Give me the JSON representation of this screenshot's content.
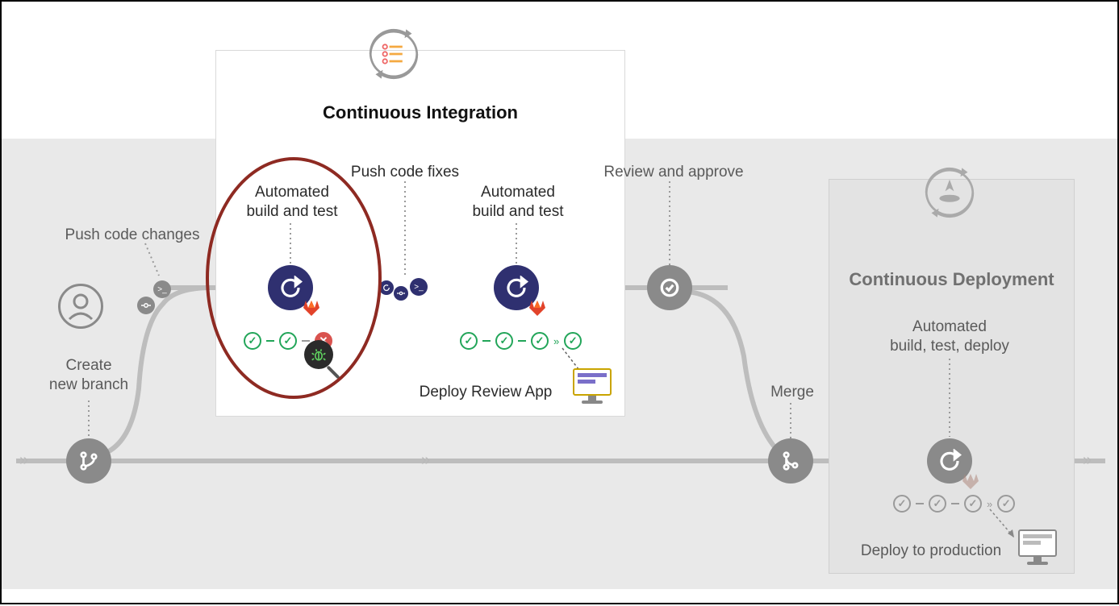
{
  "sections": {
    "ci_title": "Continuous Integration",
    "cd_title": "Continuous Deployment"
  },
  "labels": {
    "create_branch": "Create\nnew branch",
    "push_changes": "Push code changes",
    "automated_build_test_1": "Automated\nbuild and test",
    "push_fixes": "Push code fixes",
    "automated_build_test_2": "Automated\nbuild and test",
    "deploy_review_app": "Deploy Review App",
    "review_approve": "Review and approve",
    "merge": "Merge",
    "automated_btd": "Automated\nbuild, test, deploy",
    "deploy_production": "Deploy to production"
  },
  "icons": {
    "avatar": "person-icon",
    "branch": "branch-icon",
    "commit": "commit-icon",
    "terminal": "terminal-icon",
    "cycle": "cycle-icon",
    "approve": "checkmark-circle-icon",
    "merge_req": "merge-request-icon",
    "gitlab": "gitlab-logo-icon",
    "bug": "bug-magnifier-icon",
    "list": "checklist-cycle-icon",
    "rocket": "rocket-cycle-icon",
    "computer": "computer-icon"
  },
  "pipelines": {
    "first": [
      "pass",
      "pass",
      "fail"
    ],
    "second": [
      "pass",
      "pass",
      "pass",
      "pass"
    ],
    "cd": [
      "pass",
      "pass",
      "pass",
      "pass"
    ]
  },
  "colors": {
    "navy": "#2f3070",
    "gray_node": "#8a8a8a",
    "green": "#22a559",
    "red": "#d9534f",
    "highlight": "#8e2a22"
  }
}
